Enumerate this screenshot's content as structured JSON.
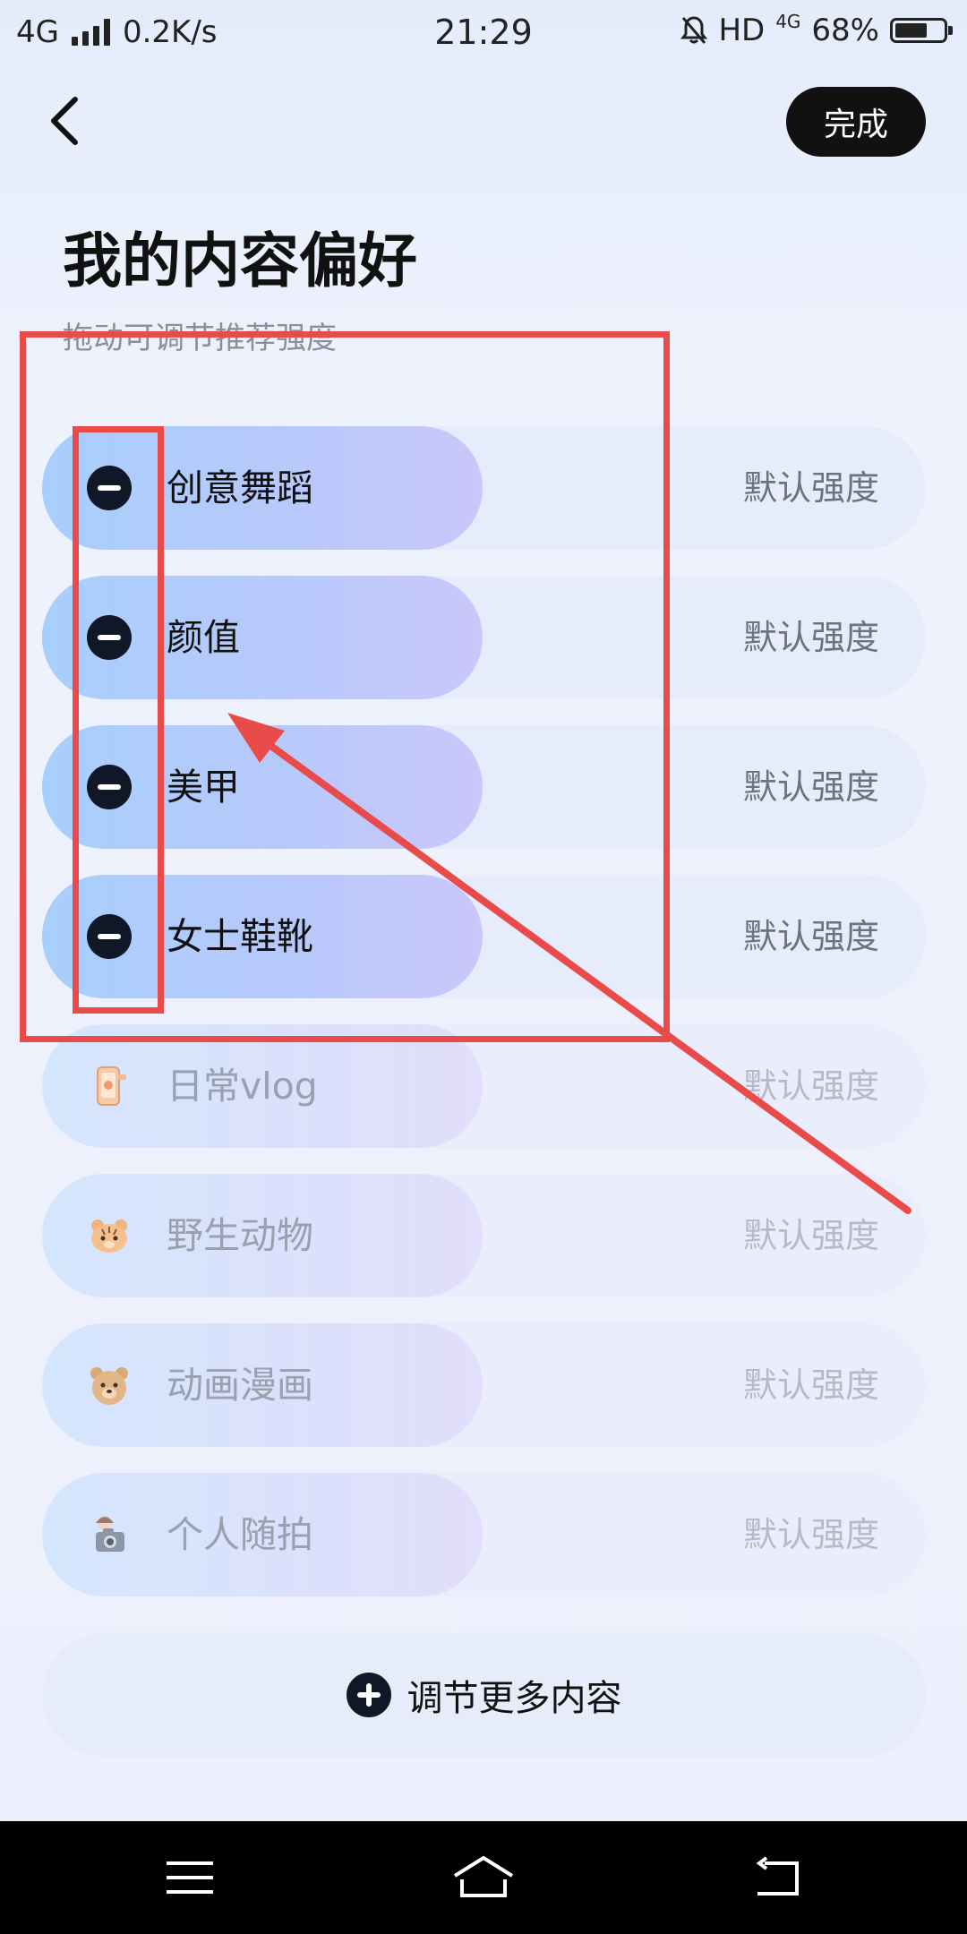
{
  "status_bar": {
    "network": "4G",
    "speed": "0.2K/s",
    "time": "21:29",
    "hd": "HD",
    "hd_network": "4G",
    "battery_percent": "68%",
    "battery_level": 0.68,
    "icons": [
      "signal-icon",
      "mute-bell-icon",
      "battery-icon"
    ]
  },
  "header": {
    "back_icon": "chevron-left-icon",
    "done_label": "完成",
    "title": "我的内容偏好",
    "subtitle": "拖动可调节推荐强度"
  },
  "preferences": {
    "active_items": [
      {
        "label": "创意舞蹈",
        "strength": "默认强度",
        "icon": "minus-circle-icon"
      },
      {
        "label": "颜值",
        "strength": "默认强度",
        "icon": "minus-circle-icon"
      },
      {
        "label": "美甲",
        "strength": "默认强度",
        "icon": "minus-circle-icon"
      },
      {
        "label": "女士鞋靴",
        "strength": "默认强度",
        "icon": "minus-circle-icon"
      }
    ],
    "inactive_items": [
      {
        "label": "日常vlog",
        "strength": "默认强度",
        "icon": "phone-vlog-icon"
      },
      {
        "label": "野生动物",
        "strength": "默认强度",
        "icon": "tiger-icon"
      },
      {
        "label": "动画漫画",
        "strength": "默认强度",
        "icon": "bear-icon"
      },
      {
        "label": "个人随拍",
        "strength": "默认强度",
        "icon": "camera-selfie-icon"
      }
    ]
  },
  "more_button": {
    "label": "调节更多内容",
    "icon": "plus-circle-icon"
  },
  "nav_bar": {
    "icons": [
      "menu-icon",
      "home-icon",
      "back-icon"
    ]
  },
  "colors": {
    "accent_dark": "#111111",
    "pill_start": "#a8cffc",
    "pill_end": "#cac7fa",
    "annotation": "#e94b4b"
  }
}
